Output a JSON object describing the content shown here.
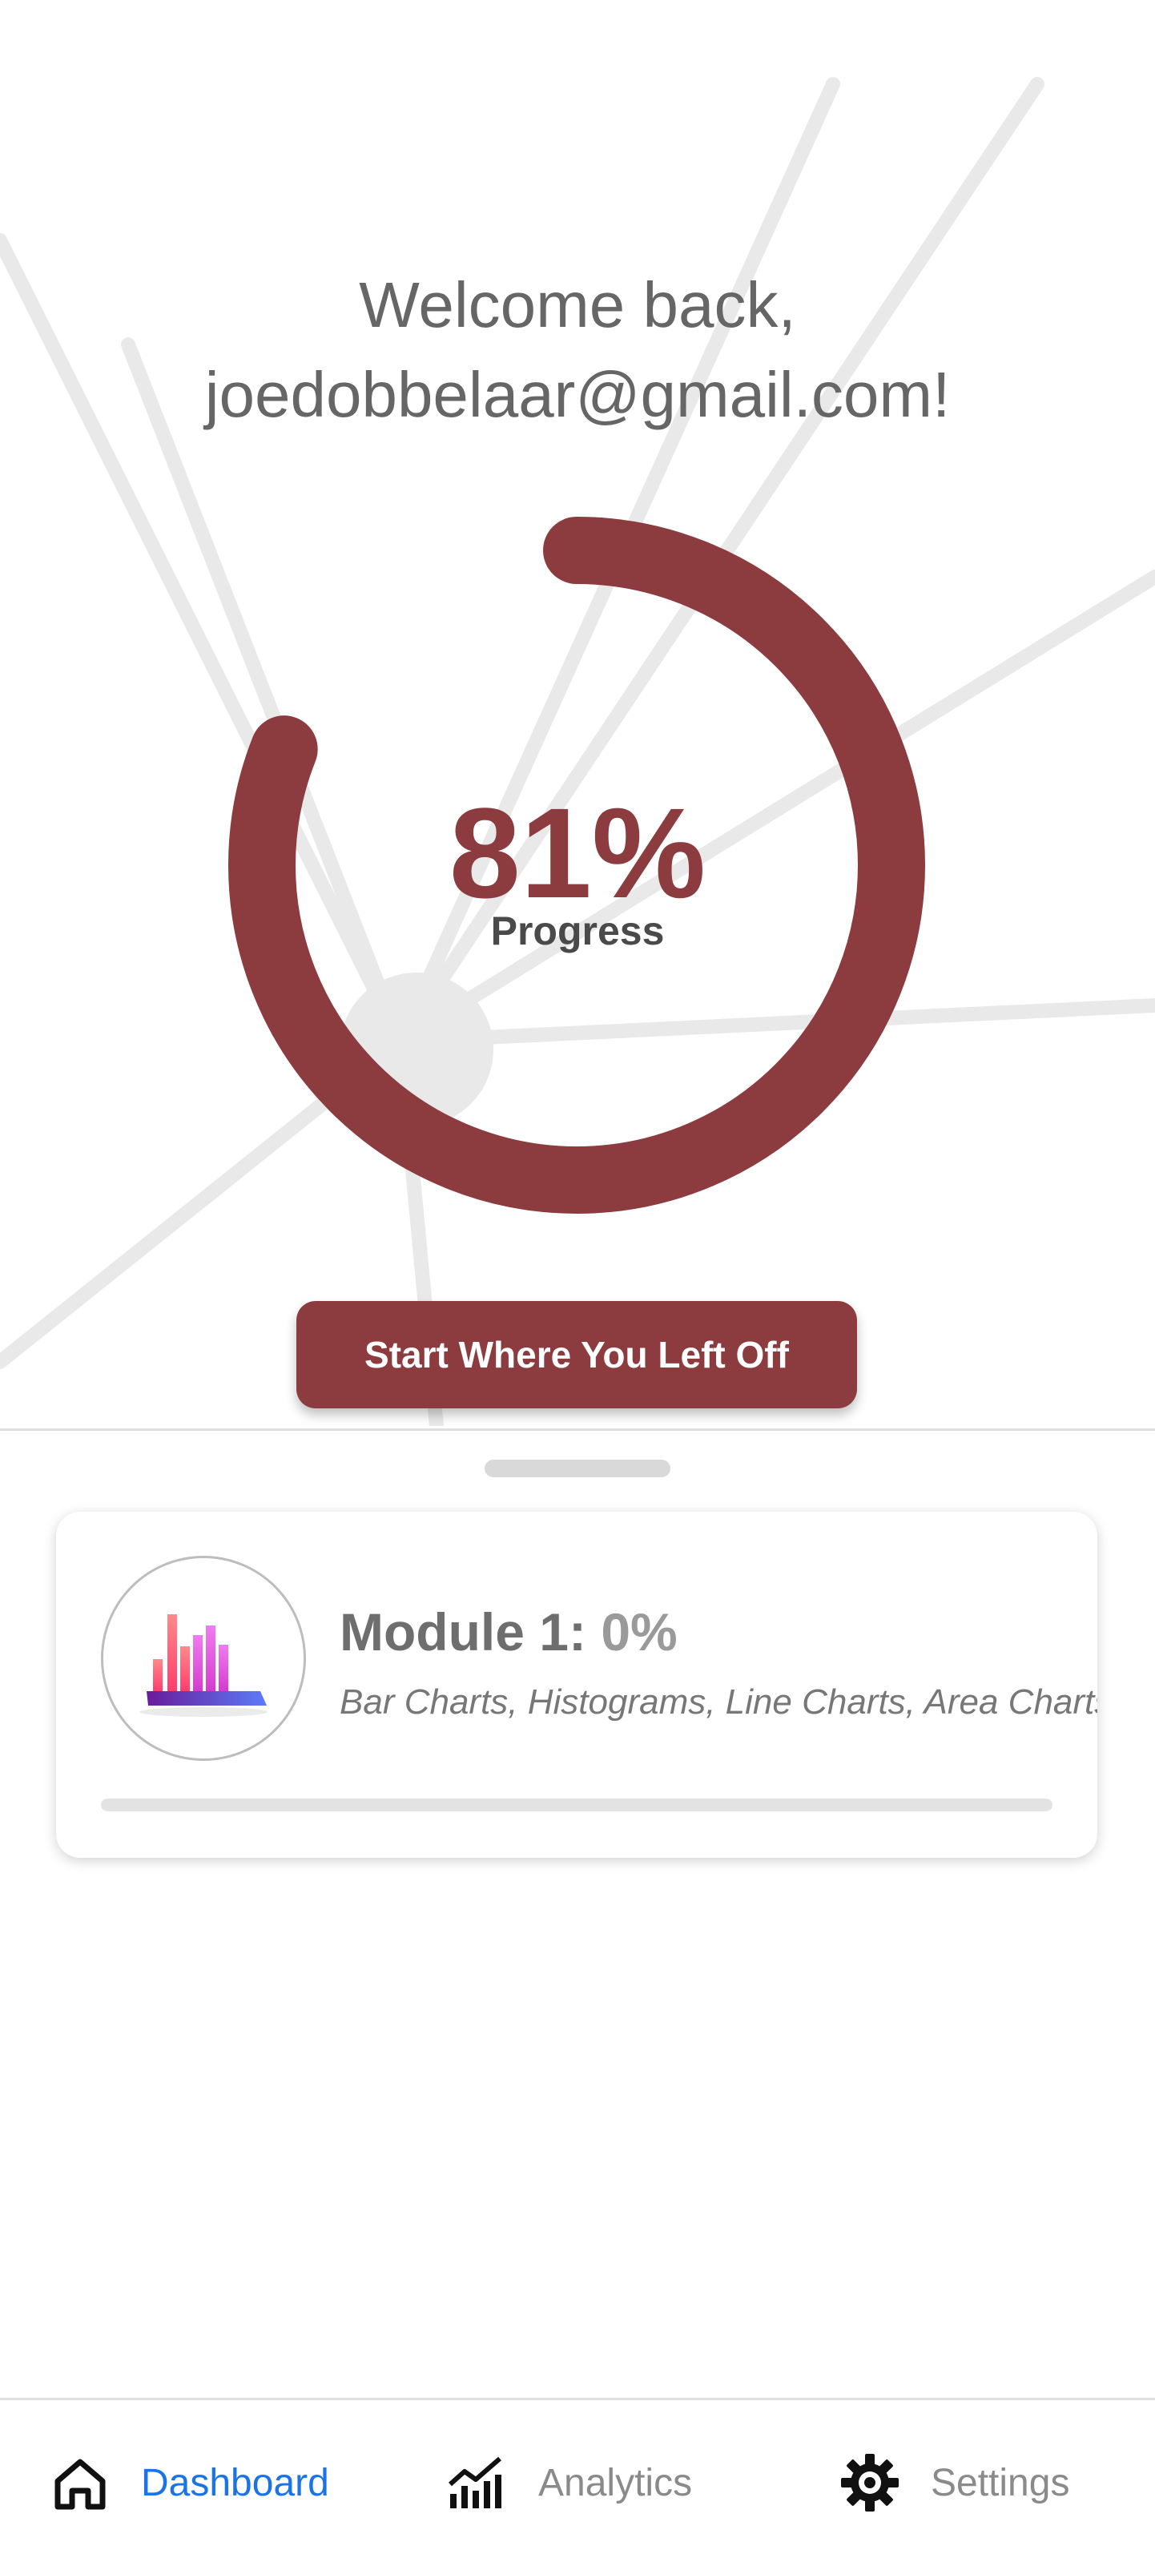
{
  "greeting": {
    "line1": "Welcome back,",
    "line2": "joedobbelaar@gmail.com!"
  },
  "progress": {
    "value_percent": 81,
    "value_text": "81%",
    "label": "Progress",
    "color": "#8c3b3e"
  },
  "start_button": {
    "label": "Start Where You Left Off"
  },
  "modules": [
    {
      "title": "Module 1:",
      "percent_text": "0%",
      "percent_value": 0,
      "description": "Bar Charts, Histograms, Line Charts, Area Charts, and",
      "icon": "bar-chart-3d-icon"
    }
  ],
  "nav": {
    "items": [
      {
        "label": "Dashboard",
        "icon": "home-icon",
        "active": true
      },
      {
        "label": "Analytics",
        "icon": "analytics-icon",
        "active": false
      },
      {
        "label": "Settings",
        "icon": "gear-icon",
        "active": false
      }
    ],
    "active_color": "#1a73e8"
  }
}
